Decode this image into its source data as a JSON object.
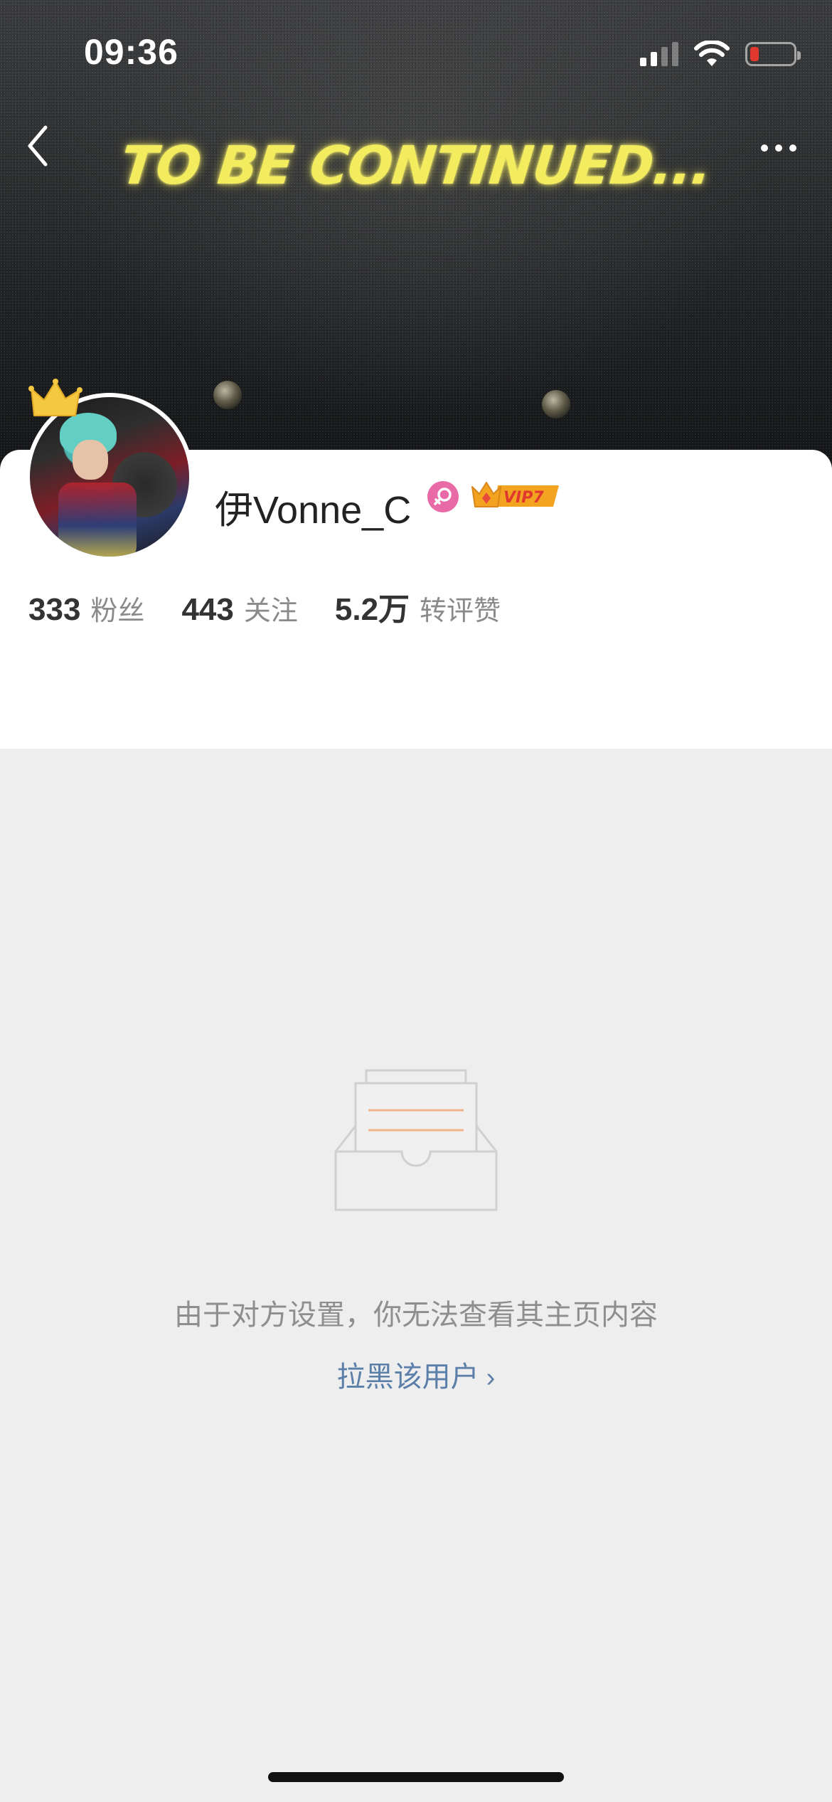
{
  "status_bar": {
    "time": "09:36",
    "icons": [
      "cellular-signal-icon",
      "wifi-icon",
      "battery-low-icon"
    ],
    "battery_color": "#e0372f"
  },
  "header": {
    "banner_text": "TO BE CONTINUED...",
    "back_icon": "chevron-left-icon",
    "more_icon": "more-horizontal-icon"
  },
  "profile": {
    "username": "伊Vonne_C",
    "gender_icon": "female-icon",
    "gender_color": "#e86aa6",
    "vip_label": "VIP7",
    "vip_color": "#f2a31f",
    "crown_icon": "crown-icon",
    "stats": [
      {
        "number": "333",
        "label": "粉丝"
      },
      {
        "number": "443",
        "label": "关注"
      },
      {
        "number": "5.2万",
        "label": "转评赞"
      }
    ]
  },
  "empty_state": {
    "illustration_icon": "empty-inbox-icon",
    "message": "由于对方设置，你无法查看其主页内容",
    "block_link": "拉黑该用户",
    "link_color": "#5b7fa8"
  }
}
